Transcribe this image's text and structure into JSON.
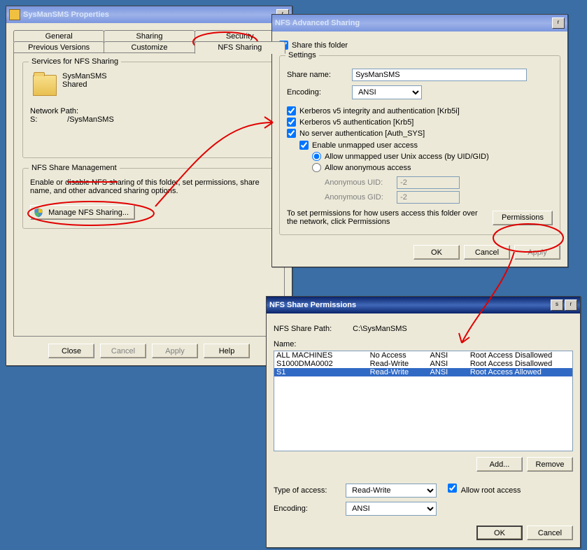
{
  "properties": {
    "title": "SysManSMS Properties",
    "tabs_row1": [
      "General",
      "Sharing",
      "Security"
    ],
    "tabs_row2": [
      "Previous Versions",
      "Customize",
      "NFS Sharing"
    ],
    "group1": {
      "title": "Services for NFS Sharing",
      "share_name": "SysManSMS",
      "share_status": "Shared",
      "netpath_label": "Network Path:",
      "netpath_value": "S:              /SysManSMS"
    },
    "group2": {
      "title": "NFS Share Management",
      "desc": "Enable or disable NFS sharing of this folder, set permissions, share name, and other advanced sharing options.",
      "btn": "Manage NFS Sharing..."
    },
    "buttons": {
      "close": "Close",
      "cancel": "Cancel",
      "apply": "Apply",
      "help": "Help"
    }
  },
  "advanced": {
    "title": "NFS Advanced Sharing",
    "share_folder": "Share this folder",
    "settings_title": "Settings",
    "share_name_label": "Share name:",
    "share_name_value": "SysManSMS",
    "encoding_label": "Encoding:",
    "encoding_value": "ANSI",
    "krb5i": "Kerberos v5 integrity and authentication [Krb5i]",
    "krb5": "Kerberos v5 authentication [Krb5]",
    "authsys": "No server authentication [Auth_SYS]",
    "unmapped": "Enable unmapped user access",
    "radio_unix": "Allow unmapped user Unix access (by UID/GID)",
    "radio_anon": "Allow anonymous access",
    "anon_uid_label": "Anonymous UID:",
    "anon_uid_value": "-2",
    "anon_gid_label": "Anonymous GID:",
    "anon_gid_value": "-2",
    "perm_text": "To set permissions for how users access this folder over the network, click Permissions",
    "perm_btn": "Permissions",
    "buttons": {
      "ok": "OK",
      "cancel": "Cancel",
      "apply": "Apply"
    }
  },
  "perms": {
    "title": "NFS Share Permissions",
    "path_label": "NFS Share Path:",
    "path_value": "C:\\SysManSMS",
    "name_label": "Name:",
    "rows": [
      {
        "name": "ALL MACHINES",
        "access": "No Access",
        "enc": "ANSI",
        "root": "Root Access Disallowed",
        "selected": false
      },
      {
        "name": "S1000DMA0002",
        "access": "Read-Write",
        "enc": "ANSI",
        "root": "Root Access Disallowed",
        "selected": false
      },
      {
        "name": "S1",
        "access": "Read-Write",
        "enc": "ANSI",
        "root": "Root Access Allowed",
        "selected": true
      }
    ],
    "add_btn": "Add...",
    "remove_btn": "Remove",
    "type_label": "Type of access:",
    "type_value": "Read-Write",
    "allow_root": "Allow root access",
    "encoding_label": "Encoding:",
    "encoding_value": "ANSI",
    "buttons": {
      "ok": "OK",
      "cancel": "Cancel"
    }
  }
}
